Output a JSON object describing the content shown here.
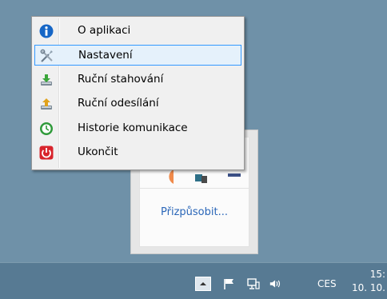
{
  "context_menu": {
    "items": [
      {
        "label": "O aplikaci",
        "icon": "info-icon",
        "highlighted": false
      },
      {
        "label": "Nastavení",
        "icon": "tools-icon",
        "highlighted": true
      },
      {
        "label": "Ruční stahování",
        "icon": "download-icon",
        "highlighted": false
      },
      {
        "label": "Ruční odesílání",
        "icon": "upload-icon",
        "highlighted": false
      },
      {
        "label": "Historie komunikace",
        "icon": "history-icon",
        "highlighted": false
      },
      {
        "label": "Ukončit",
        "icon": "power-icon",
        "highlighted": false
      }
    ]
  },
  "tray_flyout": {
    "customize_label": "Přizpůsobit..."
  },
  "taskbar": {
    "language": "CES",
    "clock_time": "15:",
    "clock_date": "10. 10."
  },
  "colors": {
    "desktop": "#6f91a8",
    "taskbar": "#577a93",
    "menu_highlight_border": "#3399ff",
    "link": "#2a66b8"
  }
}
